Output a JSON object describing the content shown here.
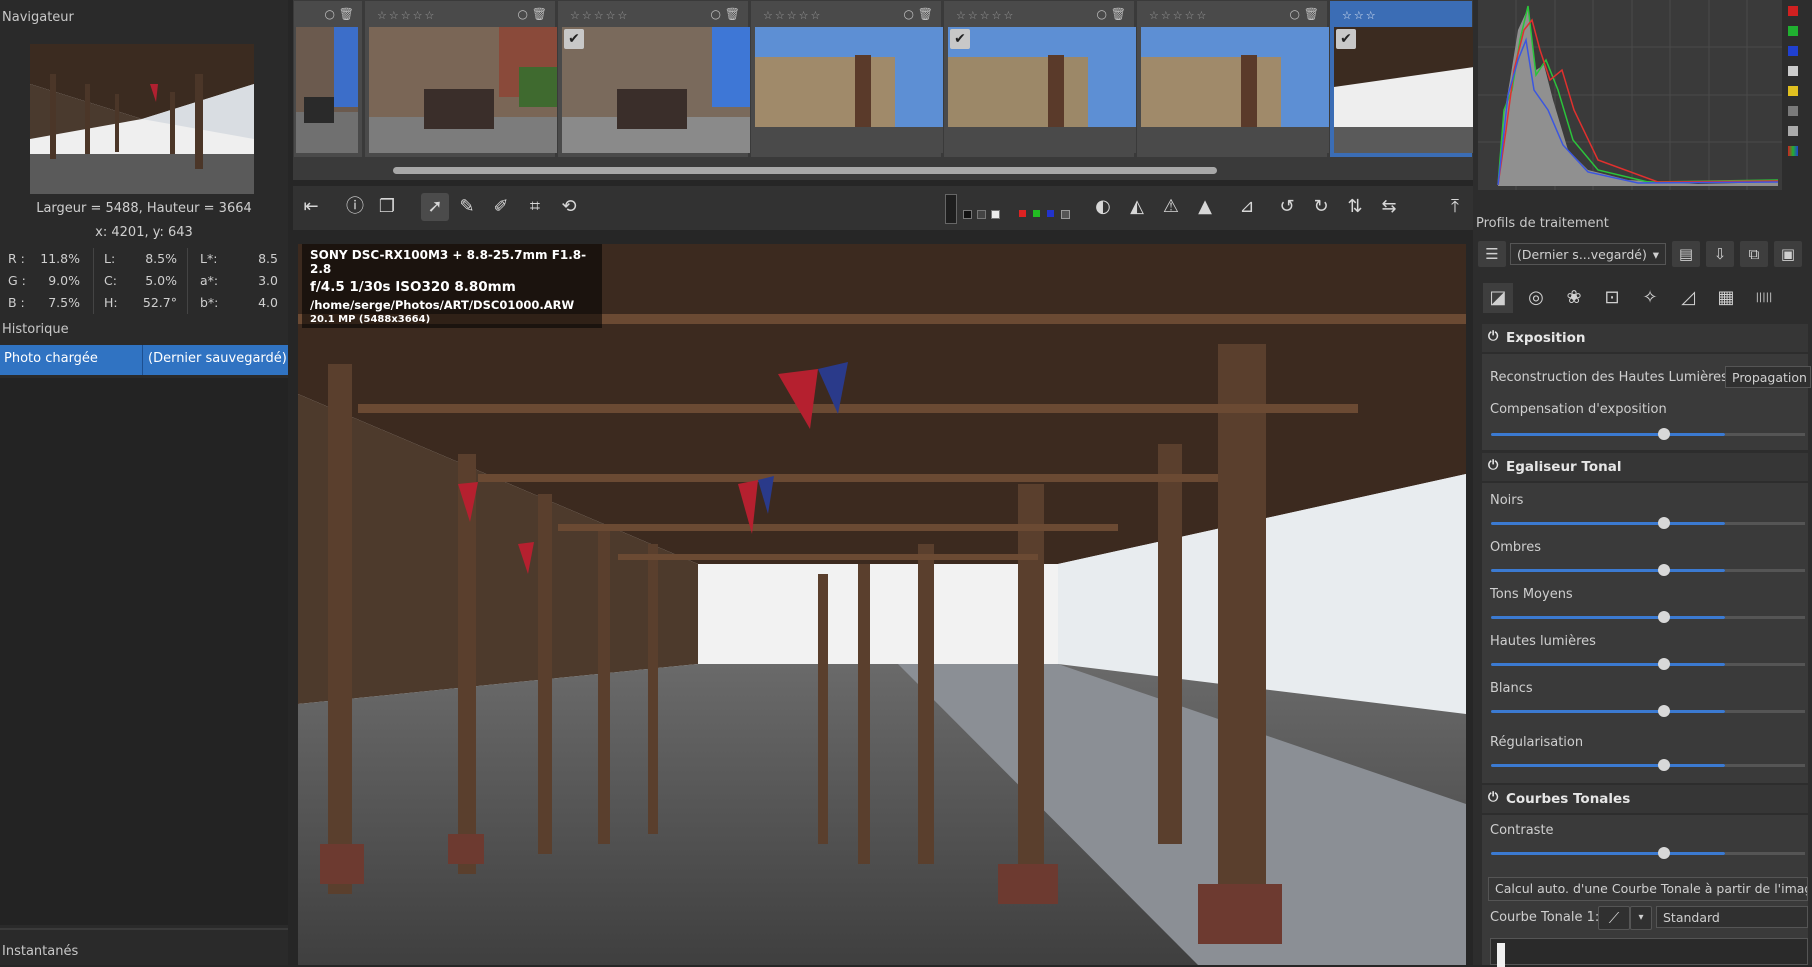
{
  "navigator": {
    "title": "Navigateur",
    "dimensions": "Largeur = 5488, Hauteur = 3664",
    "cursor": "x: 4201, y: 643",
    "rgb": [
      {
        "k": "R :",
        "v": "11.8%"
      },
      {
        "k": "G :",
        "v": "9.0%"
      },
      {
        "k": "B :",
        "v": "7.5%"
      }
    ],
    "lch": [
      {
        "k": "L:",
        "v": "8.5%"
      },
      {
        "k": "C:",
        "v": "5.0%"
      },
      {
        "k": "H:",
        "v": "52.7°"
      }
    ],
    "lab": [
      {
        "k": "L*:",
        "v": "8.5"
      },
      {
        "k": "a*:",
        "v": "3.0"
      },
      {
        "k": "b*:",
        "v": "4.0"
      }
    ]
  },
  "history": {
    "title": "Historique",
    "item": "Photo chargée",
    "item_detail": "(Dernier sauvegardé)"
  },
  "snapshots": {
    "title": "Instantanés"
  },
  "filmstrip": {
    "thumbs": [
      {
        "stars": "☆☆☆☆☆"
      },
      {
        "stars": "☆☆☆☆☆"
      },
      {
        "stars": "☆☆☆☆☆"
      },
      {
        "stars": "☆☆☆☆☆"
      },
      {
        "stars": "☆☆☆☆☆"
      },
      {
        "stars": "☆☆☆☆☆"
      },
      {
        "stars": "☆☆☆"
      }
    ]
  },
  "exif": {
    "camera": "SONY DSC-RX100M3 + 8.8-25.7mm F1.8-2.8",
    "settings": "f/4.5  1/30s  ISO320  8.80mm",
    "path": "/home/serge/Photos/ART/DSC01000.ARW",
    "size": "20.1 MP (5488x3664)"
  },
  "profiles": {
    "title": "Profils de traitement",
    "selected": "(Dernier s...vegardé)"
  },
  "exposure": {
    "title": "Exposition",
    "hl_label": "Reconstruction des Hautes Lumières:",
    "hl_value": "Propagation",
    "comp_label": "Compensation d'exposition",
    "comp_value": 0.55
  },
  "tone_eq": {
    "title": "Egaliseur Tonal",
    "bands": [
      {
        "label": "Noirs",
        "value": 0.55
      },
      {
        "label": "Ombres",
        "value": 0.55
      },
      {
        "label": "Tons Moyens",
        "value": 0.55
      },
      {
        "label": "Hautes lumières",
        "value": 0.55
      },
      {
        "label": "Blancs",
        "value": 0.55
      },
      {
        "label": "Régularisation",
        "value": 0.55
      }
    ]
  },
  "curves": {
    "title": "Courbes Tonales",
    "contrast_label": "Contraste",
    "contrast_value": 0.55,
    "auto_button": "Calcul auto. d'une Courbe Tonale à partir de l'image",
    "curve1_label": "Courbe Tonale 1:",
    "curve1_mode": "Standard"
  },
  "colors": {
    "accent": "#3b7ad1",
    "selection": "#3073c2"
  }
}
